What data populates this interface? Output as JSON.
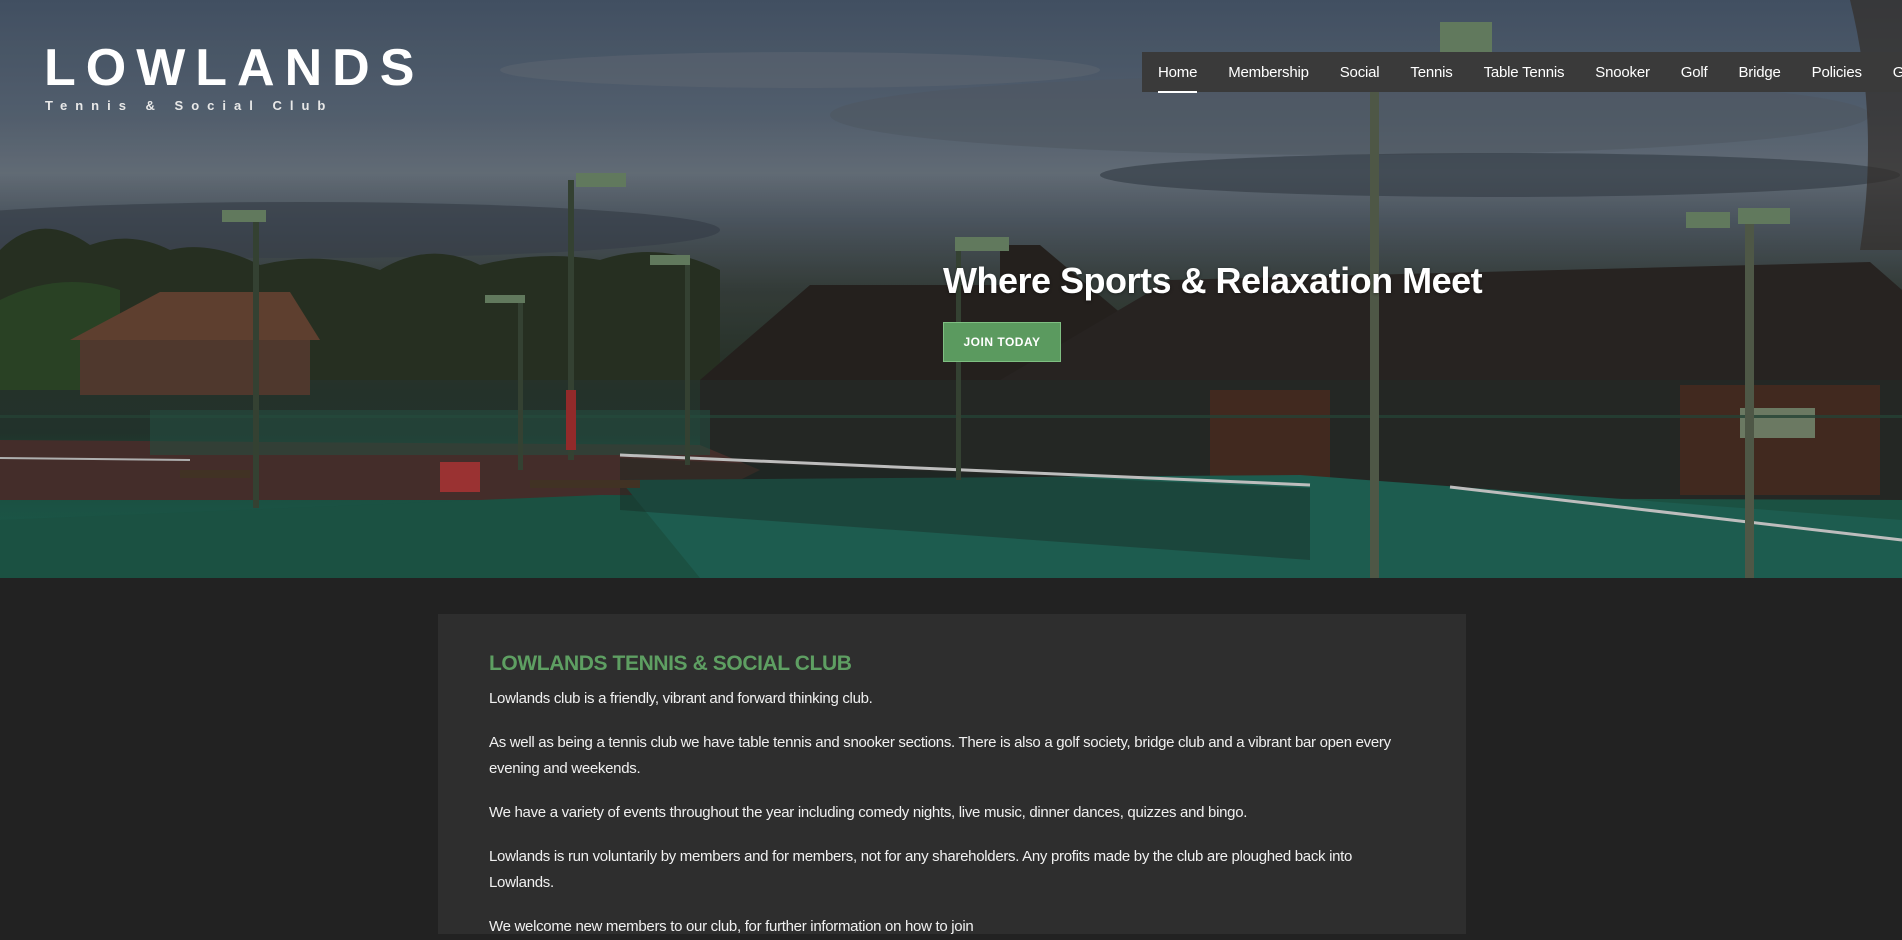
{
  "logo": {
    "title": "LOWLANDS",
    "subtitle": "Tennis & Social Club"
  },
  "nav": {
    "items": [
      {
        "label": "Home",
        "active": true
      },
      {
        "label": "Membership",
        "active": false
      },
      {
        "label": "Social",
        "active": false
      },
      {
        "label": "Tennis",
        "active": false
      },
      {
        "label": "Table Tennis",
        "active": false
      },
      {
        "label": "Snooker",
        "active": false
      },
      {
        "label": "Golf",
        "active": false
      },
      {
        "label": "Bridge",
        "active": false
      },
      {
        "label": "Policies",
        "active": false
      },
      {
        "label": "Gallery",
        "active": false
      }
    ]
  },
  "hero": {
    "heading": "Where Sports & Relaxation Meet",
    "button_label": "JOIN TODAY"
  },
  "content": {
    "heading": "LOWLANDS TENNIS & SOCIAL CLUB",
    "paragraphs": [
      "Lowlands club is a friendly, vibrant and forward thinking club.",
      "As well as being a tennis club we have table tennis and snooker sections.  There is also a golf society, bridge club and a vibrant bar open every evening and weekends.",
      "We have a variety of events throughout the year including comedy nights, live music, dinner dances, quizzes and bingo.",
      "Lowlands is run voluntarily by members and for members, not for any shareholders. Any profits made by the club are ploughed back into Lowlands.",
      "We welcome new members to our club, for further information on how to join"
    ]
  },
  "colors": {
    "accent_green": "#5e9f62",
    "button_green": "#5b9a5f",
    "nav_bg": "#3a3a3a",
    "page_bg": "#222222",
    "card_bg": "#2e2e2e"
  }
}
